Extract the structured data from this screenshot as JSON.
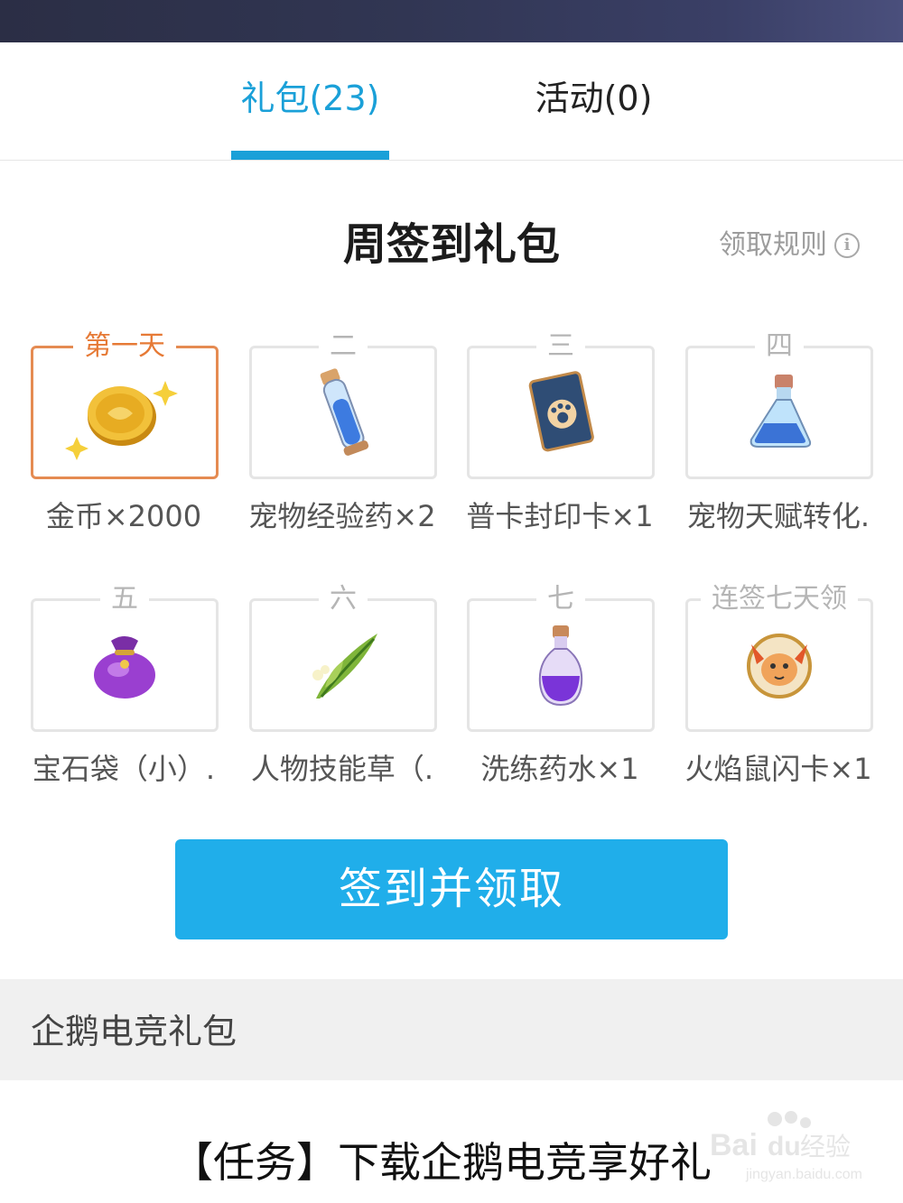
{
  "tabs": [
    {
      "label": "礼包(23)",
      "active": true
    },
    {
      "label": "活动(0)",
      "active": false
    }
  ],
  "colors": {
    "accent": "#1aa0d8",
    "active_day": "#e67a36",
    "button": "#20aeea"
  },
  "weekly_gift": {
    "title": "周签到礼包",
    "rules_label": "领取规则",
    "rules_icon": "info-icon",
    "days": [
      {
        "label": "第一天",
        "item": "金币×2000",
        "icon": "gold-coin-icon",
        "active": true
      },
      {
        "label": "二",
        "item": "宠物经验药×2",
        "icon": "exp-potion-tube-icon",
        "active": false
      },
      {
        "label": "三",
        "item": "普卡封印卡×1",
        "icon": "seal-card-icon",
        "active": false
      },
      {
        "label": "四",
        "item": "宠物天赋转化.",
        "icon": "talent-flask-icon",
        "active": false
      },
      {
        "label": "五",
        "item": "宝石袋（小）.",
        "icon": "gem-bag-icon",
        "active": false
      },
      {
        "label": "六",
        "item": "人物技能草（.",
        "icon": "skill-herb-icon",
        "active": false
      },
      {
        "label": "七",
        "item": "洗练药水×1",
        "icon": "refine-potion-icon",
        "active": false
      },
      {
        "label": "连签七天领",
        "item": "火焰鼠闪卡×1",
        "icon": "fire-mouse-card-icon",
        "active": false
      }
    ],
    "button_label": "签到并领取"
  },
  "esports_section": {
    "title": "企鹅电竞礼包"
  },
  "task": {
    "title": "【任务】下载企鹅电竞享好礼"
  },
  "watermark": {
    "brand": "Bai",
    "brand2": "du",
    "suffix": "经验",
    "url": "jingyan.baidu.com"
  }
}
